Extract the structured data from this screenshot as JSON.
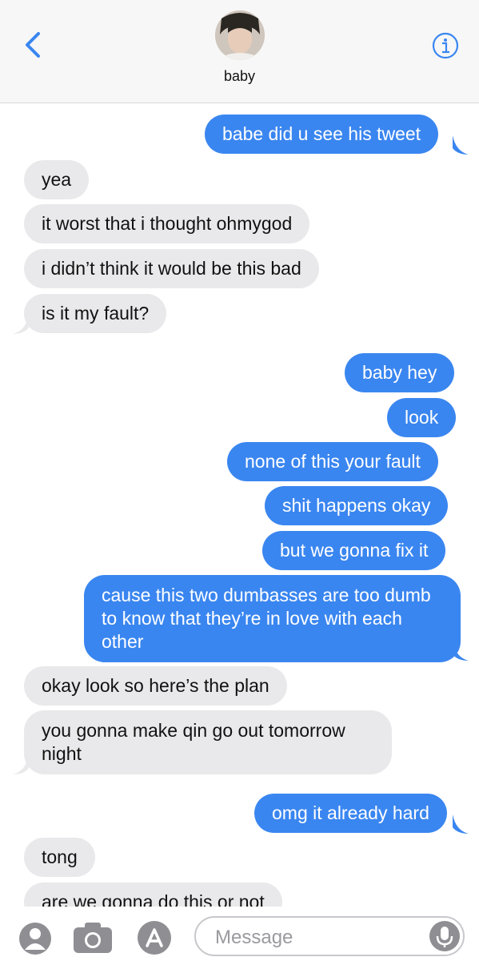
{
  "header": {
    "contact_name": "baby",
    "accent": "#3a86f0"
  },
  "messages": [
    {
      "dir": "out",
      "text": "babe did u see his tweet",
      "tail": true
    },
    {
      "dir": "in",
      "text": "yea"
    },
    {
      "dir": "in",
      "text": "it worst that i thought ohmygod"
    },
    {
      "dir": "in",
      "text": "i didn’t think it would be this bad"
    },
    {
      "dir": "in",
      "text": "is it my fault?",
      "tail": true
    },
    {
      "dir": "out",
      "text": "baby hey"
    },
    {
      "dir": "out",
      "text": "look"
    },
    {
      "dir": "out",
      "text": "none of this your fault"
    },
    {
      "dir": "out",
      "text": "shit happens okay"
    },
    {
      "dir": "out",
      "text": "but we gonna fix it"
    },
    {
      "dir": "out",
      "text": "cause this two dumbasses are too dumb to know that they’re in love with each other",
      "tail": true
    },
    {
      "dir": "in",
      "text": "okay look so here’s the plan"
    },
    {
      "dir": "in",
      "text": "you gonna make qin go out tomorrow night",
      "tail": true
    },
    {
      "dir": "out",
      "text": "omg it already hard",
      "tail": true
    },
    {
      "dir": "in",
      "text": "tong"
    },
    {
      "dir": "in",
      "text": "are we gonna do this or not"
    }
  ],
  "composer": {
    "placeholder": "Message",
    "icons": [
      "contact-icon",
      "camera-icon",
      "app-store-icon",
      "microphone-icon"
    ]
  },
  "colors": {
    "outgoing_bubble": "#3a86f0",
    "incoming_bubble": "#e9e9eb",
    "header_bg": "#f7f7f7"
  }
}
